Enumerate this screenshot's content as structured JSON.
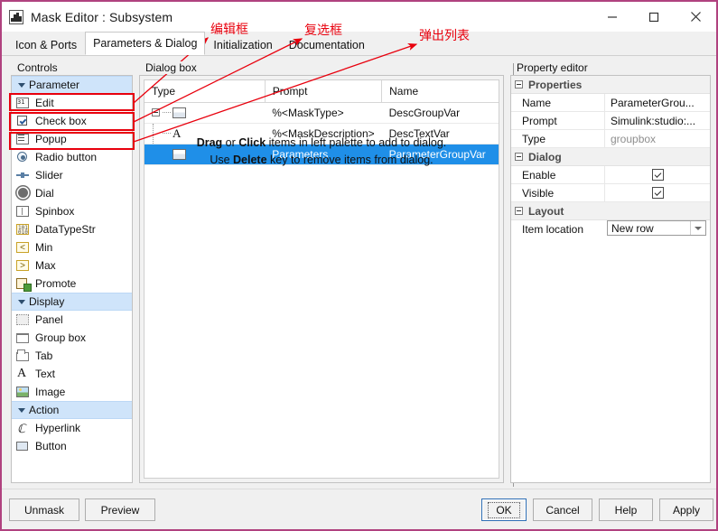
{
  "window": {
    "title": "Mask Editor : Subsystem",
    "icon": "mask-editor-icon",
    "minimize": "minimize-icon",
    "maximize": "maximize-icon",
    "close": "close-icon"
  },
  "tabs": [
    {
      "label": "Icon & Ports",
      "active": false
    },
    {
      "label": "Parameters & Dialog",
      "active": true
    },
    {
      "label": "Initialization",
      "active": false
    },
    {
      "label": "Documentation",
      "active": false
    }
  ],
  "controls": {
    "label": "Controls",
    "items": [
      {
        "label": "Parameter",
        "icon": "caret-down-icon",
        "type": "group"
      },
      {
        "label": "Edit",
        "icon": "edit-field-icon",
        "type": "item",
        "highlight": true
      },
      {
        "label": "Check box",
        "icon": "checkbox-icon",
        "type": "item",
        "highlight": true
      },
      {
        "label": "Popup",
        "icon": "popup-list-icon",
        "type": "item",
        "highlight": true
      },
      {
        "label": "Radio button",
        "icon": "radio-button-icon",
        "type": "item"
      },
      {
        "label": "Slider",
        "icon": "slider-icon",
        "type": "item"
      },
      {
        "label": "Dial",
        "icon": "dial-icon",
        "type": "item"
      },
      {
        "label": "Spinbox",
        "icon": "spinbox-icon",
        "type": "item"
      },
      {
        "label": "DataTypeStr",
        "icon": "datatype-icon",
        "type": "item"
      },
      {
        "label": "Min",
        "icon": "min-icon",
        "type": "item"
      },
      {
        "label": "Max",
        "icon": "max-icon",
        "type": "item"
      },
      {
        "label": "Promote",
        "icon": "promote-icon",
        "type": "item"
      },
      {
        "label": "Display",
        "icon": "caret-down-icon",
        "type": "group"
      },
      {
        "label": "Panel",
        "icon": "panel-icon",
        "type": "item"
      },
      {
        "label": "Group box",
        "icon": "group-box-icon",
        "type": "item"
      },
      {
        "label": "Tab",
        "icon": "tab-icon",
        "type": "item"
      },
      {
        "label": "Text",
        "icon": "text-icon",
        "type": "item"
      },
      {
        "label": "Image",
        "icon": "image-icon",
        "type": "item"
      },
      {
        "label": "Action",
        "icon": "caret-down-icon",
        "type": "group"
      },
      {
        "label": "Hyperlink",
        "icon": "hyperlink-icon",
        "type": "item"
      },
      {
        "label": "Button",
        "icon": "button-icon",
        "type": "item"
      }
    ]
  },
  "dialog_box": {
    "label": "Dialog box",
    "columns": [
      "Type",
      "Prompt",
      "Name"
    ],
    "rows": [
      {
        "icon": "group-box-icon",
        "tree": "expander",
        "prompt": "%<MaskType>",
        "name": "DescGroupVar",
        "selected": false
      },
      {
        "icon": "text-icon",
        "tree": "child",
        "prompt": "%<MaskDescription>",
        "name": "DescTextVar",
        "selected": false
      },
      {
        "icon": "group-box-icon",
        "tree": "child",
        "prompt": "Parameters",
        "name": "ParameterGroupVar",
        "selected": true
      }
    ],
    "hint_line1_pre": "Drag",
    "hint_line1_mid": " or ",
    "hint_line1_b2": "Click",
    "hint_line1_post": " items in left palette to add to dialog.",
    "hint_line2_pre": "Use ",
    "hint_line2_b": "Delete",
    "hint_line2_post": " key to remove items from dialog."
  },
  "property_editor": {
    "label": "Property editor",
    "sections": [
      {
        "title": "Properties",
        "rows": [
          {
            "key": "Name",
            "value": "ParameterGrou...",
            "kind": "text"
          },
          {
            "key": "Prompt",
            "value": "Simulink:studio:...",
            "kind": "text"
          },
          {
            "key": "Type",
            "value": "groupbox",
            "kind": "readonly"
          }
        ]
      },
      {
        "title": "Dialog",
        "rows": [
          {
            "key": "Enable",
            "value": "checked",
            "kind": "checkbox"
          },
          {
            "key": "Visible",
            "value": "checked",
            "kind": "checkbox"
          }
        ]
      },
      {
        "title": "Layout",
        "rows": [
          {
            "key": "Item location",
            "value": "New row",
            "kind": "combo"
          }
        ]
      }
    ]
  },
  "footer": {
    "unmask": "Unmask",
    "preview": "Preview",
    "ok": "OK",
    "cancel": "Cancel",
    "help": "Help",
    "apply": "Apply"
  },
  "annotations": [
    {
      "text": "编辑框",
      "note": "edit-box-annotation"
    },
    {
      "text": "复选框",
      "note": "checkbox-annotation"
    },
    {
      "text": "弹出列表",
      "note": "popup-list-annotation"
    }
  ],
  "colors": {
    "window_border": "#b0427f",
    "selection_blue": "#1f8fe8",
    "group_header_blue": "#cfe4fa",
    "annotation_red": "#e8000d",
    "focus_blue": "#2f6fb5"
  }
}
